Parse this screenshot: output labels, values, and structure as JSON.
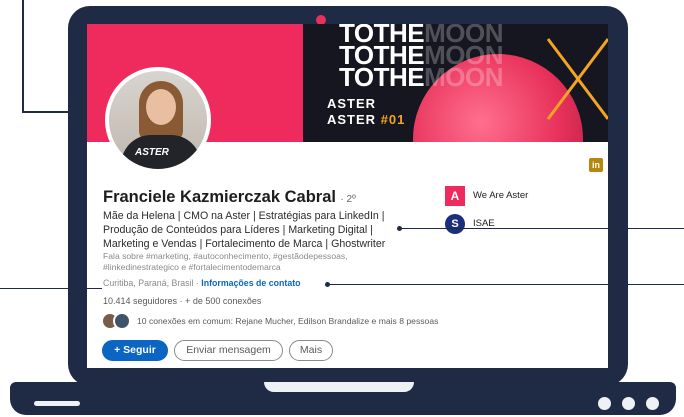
{
  "banner": {
    "lines": [
      "TOTHE MOON",
      "TOTHE MOON",
      "TOTHE MOON"
    ],
    "tag_line1": "ASTER",
    "tag_line2": "ASTER",
    "tag_number": "#01"
  },
  "avatar": {
    "shirt_text": "ASTER"
  },
  "linkedin_badge": "in",
  "profile": {
    "name": "Franciele Kazmierczak Cabral",
    "degree": "· 2º",
    "headline": "Mãe da Helena | CMO na Aster | Estratégias para LinkedIn | Produção de Conteúdos para Líderes | Marketing Digital | Marketing e Vendas | Fortalecimento de Marca | Ghostwriter",
    "about": "Fala sobre #marketing, #autoconhecimento, #gestãodepessoas, #linkedinestrategico e #fortalecimentodemarca",
    "location": "Curitiba, Paraná, Brasil",
    "location_separator": " · ",
    "contact_link": "Informações de contato",
    "followers": "10.414 seguidores",
    "connections": " · + de 500 conexões",
    "common_connections": "10 conexões em comum: Rejane Mucher, Edilson Brandalize e mais 8 pessoas"
  },
  "companies": [
    {
      "name": "We Are Aster",
      "logo_letter": "A"
    },
    {
      "name": "ISAE",
      "logo_letter": "S"
    }
  ],
  "actions": {
    "follow": "+ Seguir",
    "message": "Enviar mensagem",
    "more": "Mais"
  },
  "colors": {
    "laptop": "#1f2a44",
    "brand_pink": "#ee2b5c",
    "linkedin_blue": "#0a66c2"
  }
}
